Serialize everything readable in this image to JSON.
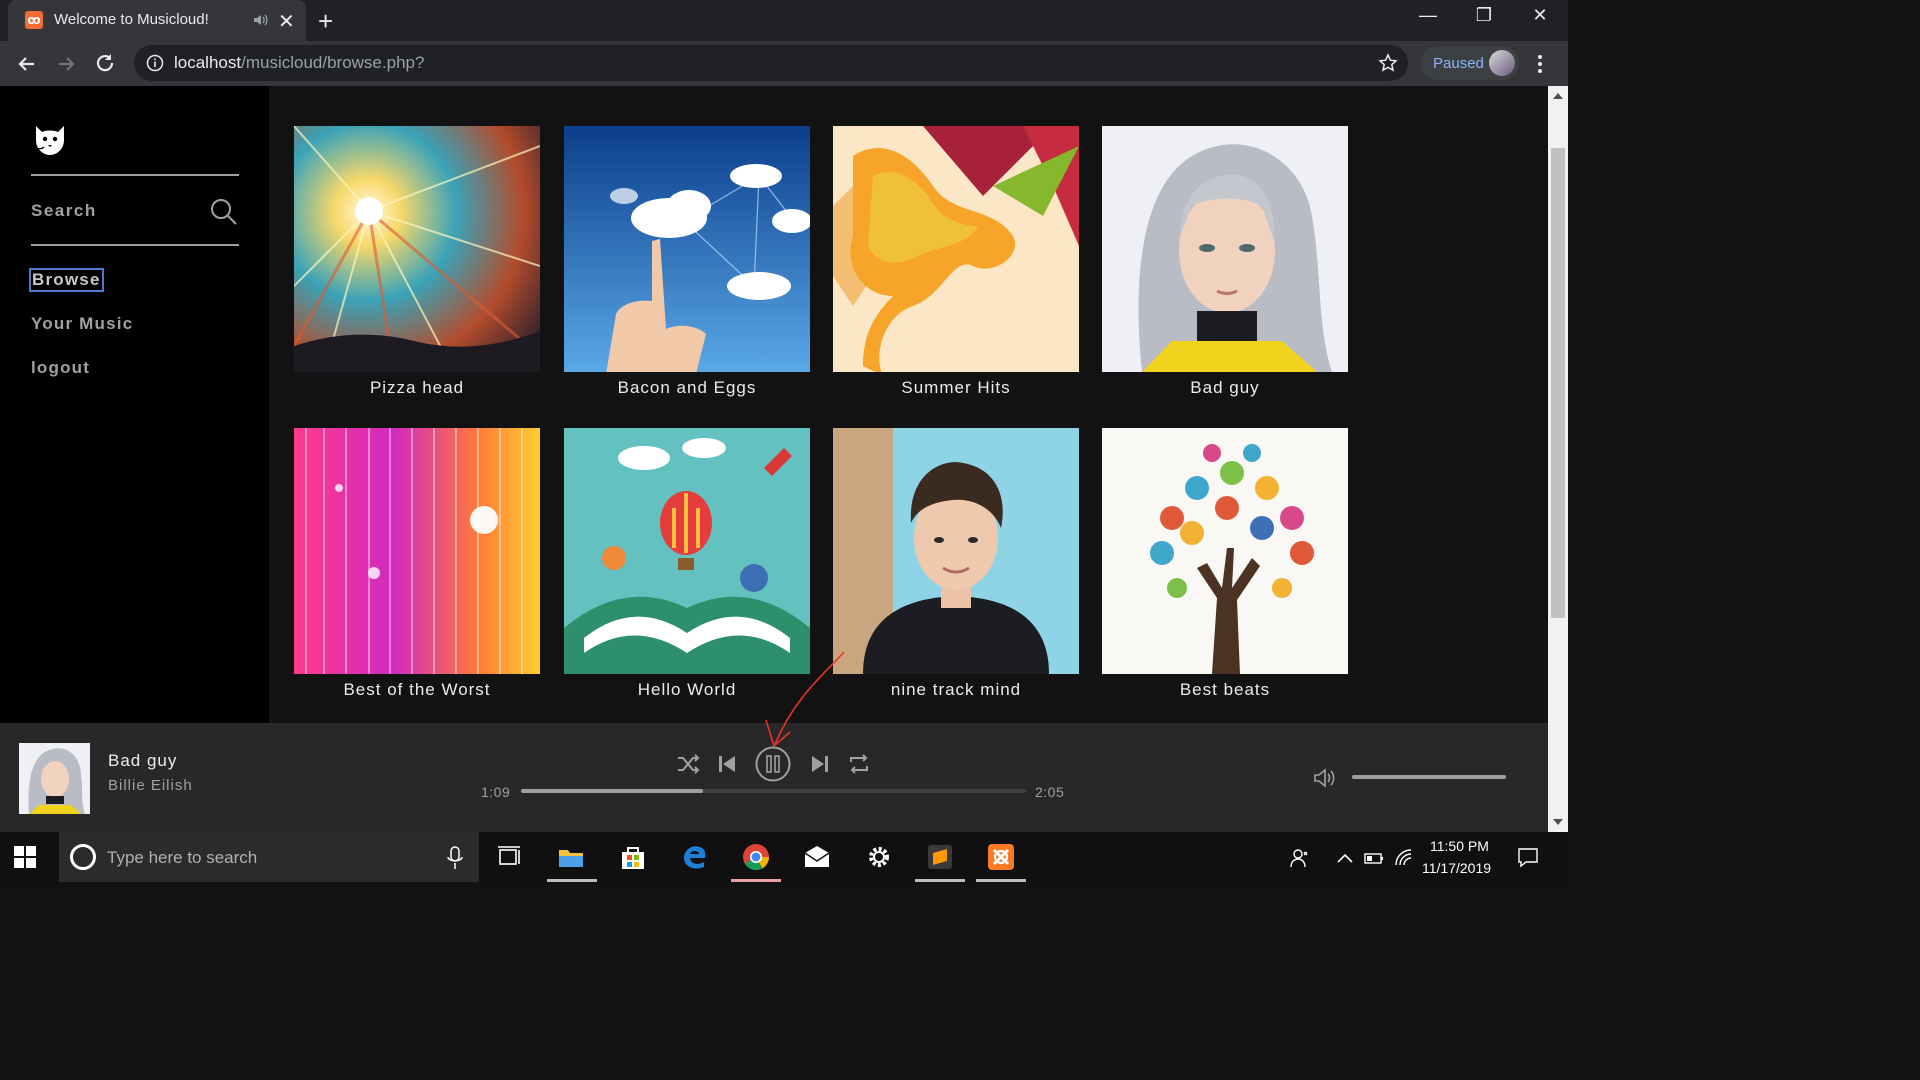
{
  "browser": {
    "tab_title": "Welcome to Musicloud!",
    "tab_favicon": "xampp-favicon",
    "url_host": "localhost",
    "url_path": "/musicloud/browse.php?",
    "profile_status": "Paused"
  },
  "sidebar": {
    "logo": "cat-logo-icon",
    "search_label": "Search",
    "nav": [
      {
        "label": "Browse",
        "active": true
      },
      {
        "label": "Your Music",
        "active": false
      },
      {
        "label": "logout",
        "active": false
      }
    ]
  },
  "albums": [
    {
      "title": "Pizza head"
    },
    {
      "title": "Bacon and Eggs"
    },
    {
      "title": "Summer Hits"
    },
    {
      "title": "Bad guy"
    },
    {
      "title": "Best of the Worst"
    },
    {
      "title": "Hello World"
    },
    {
      "title": "nine track mind"
    },
    {
      "title": "Best beats"
    }
  ],
  "player": {
    "track": "Bad guy",
    "artist": "Billie Eilish",
    "current_time": "1:09",
    "total_time": "2:05",
    "progress": 0.36,
    "volume": 1.0,
    "state": "playing"
  },
  "taskbar": {
    "search_placeholder": "Type here to search",
    "time": "11:50 PM",
    "date": "11/17/2019"
  },
  "colors": {
    "accent": "#e8322a",
    "text": "#a0a0a0",
    "background": "#121212"
  }
}
